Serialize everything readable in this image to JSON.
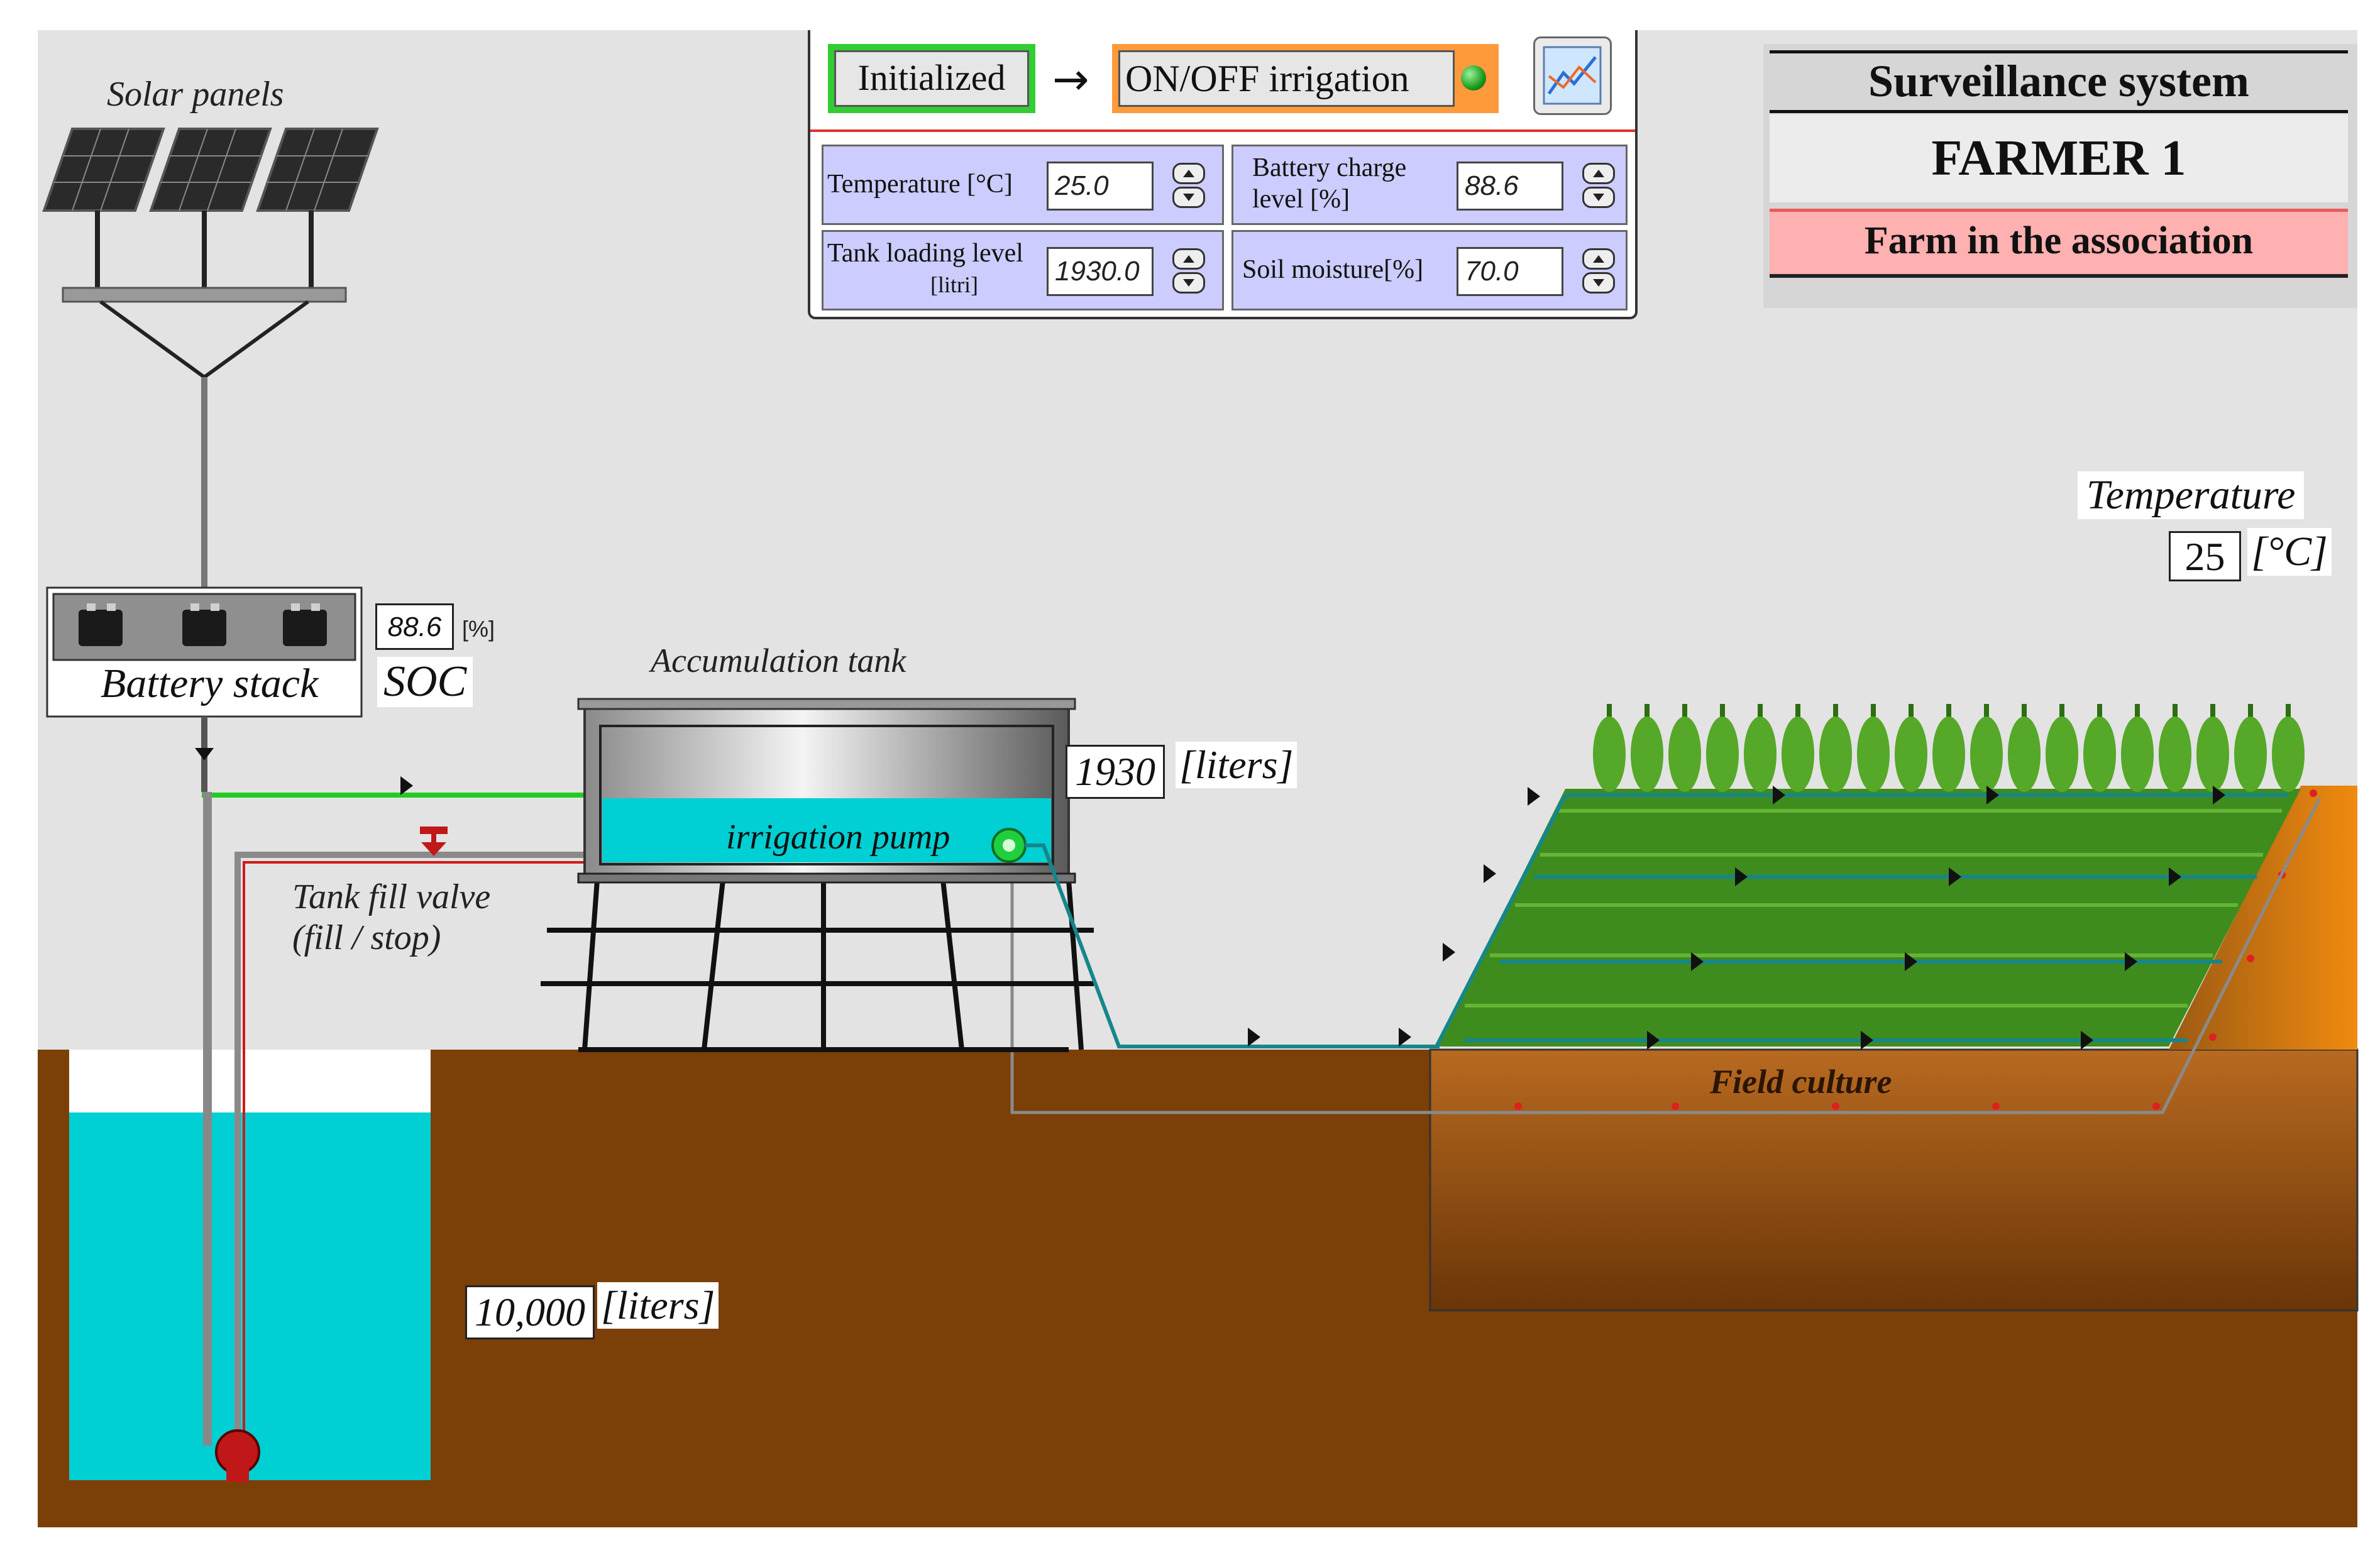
{
  "scene": {
    "solar_panels_label": "Solar panels",
    "battery_stack_label": "Battery stack",
    "soc_label": "SOC",
    "soc_value": "88.6",
    "soc_unit": "[%]",
    "accumulation_tank_label": "Accumulation tank",
    "tank_level_value": "1930",
    "tank_level_unit": "[liters]",
    "irrigation_pump_label": "irrigation pump",
    "tank_fill_valve_label": "Tank fill valve",
    "tank_fill_valve_sub": "(fill / stop)",
    "well_volume_value": "10,000",
    "well_volume_unit": "[liters]",
    "field_culture_label": "Field culture",
    "temperature_label": "Temperature",
    "temperature_value": "25",
    "temperature_unit": "[°C]"
  },
  "control_panel": {
    "initialized_button": "Initialized",
    "arrow": "→",
    "onoff_button": "ON/OFF irrigation",
    "status_led_color": "#1c9b1c",
    "chart_icon": "line-chart-icon",
    "fields": {
      "temperature_label": "Temperature [°C]",
      "temperature_value": "25.0",
      "battery_label_line1": "Battery charge",
      "battery_label_line2": "level [%]",
      "battery_value": "88.6",
      "tank_label_line1": "Tank loading level",
      "tank_label_line2": "[litri]",
      "tank_value": "1930.0",
      "soil_label": "Soil moisture[%]",
      "soil_value": "70.0"
    }
  },
  "surveillance": {
    "title": "Surveillance system",
    "farmer": "FARMER 1",
    "association": "Farm in the association"
  },
  "colors": {
    "sky": "#e3e3e3",
    "soil": "#7b3f07",
    "water": "#00cfd3",
    "green_pipe": "#22cc22",
    "teal_pipe": "#15868b",
    "panel_bg": "#ccccff",
    "association_bg": "#ffb0b0"
  }
}
